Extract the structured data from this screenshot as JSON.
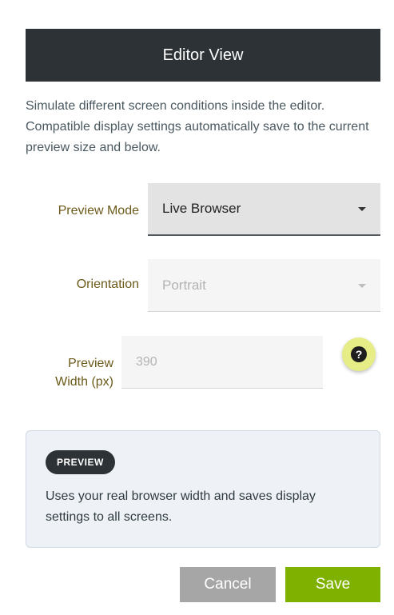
{
  "dialog": {
    "title": "Editor View",
    "description": "Simulate different screen conditions inside the editor. Compatible display settings automatically save to the current preview size and below."
  },
  "fields": {
    "preview_mode": {
      "label": "Preview Mode",
      "value": "Live Browser"
    },
    "orientation": {
      "label": "Orientation",
      "value": "Portrait"
    },
    "preview_width": {
      "label_line1": "Preview",
      "label_line2": "Width (px)",
      "placeholder": "390"
    }
  },
  "help": {
    "icon": "question-mark-icon",
    "glyph": "?"
  },
  "info": {
    "badge": "PREVIEW",
    "text": "Uses your real browser width and saves display settings to all screens."
  },
  "actions": {
    "cancel_label": "Cancel",
    "save_label": "Save"
  },
  "colors": {
    "header_bg": "#2c3236",
    "save_bg": "#7fb200",
    "cancel_bg": "#a6a6a6",
    "help_bg": "#e6ec86",
    "label_color": "#6b5a1a"
  }
}
